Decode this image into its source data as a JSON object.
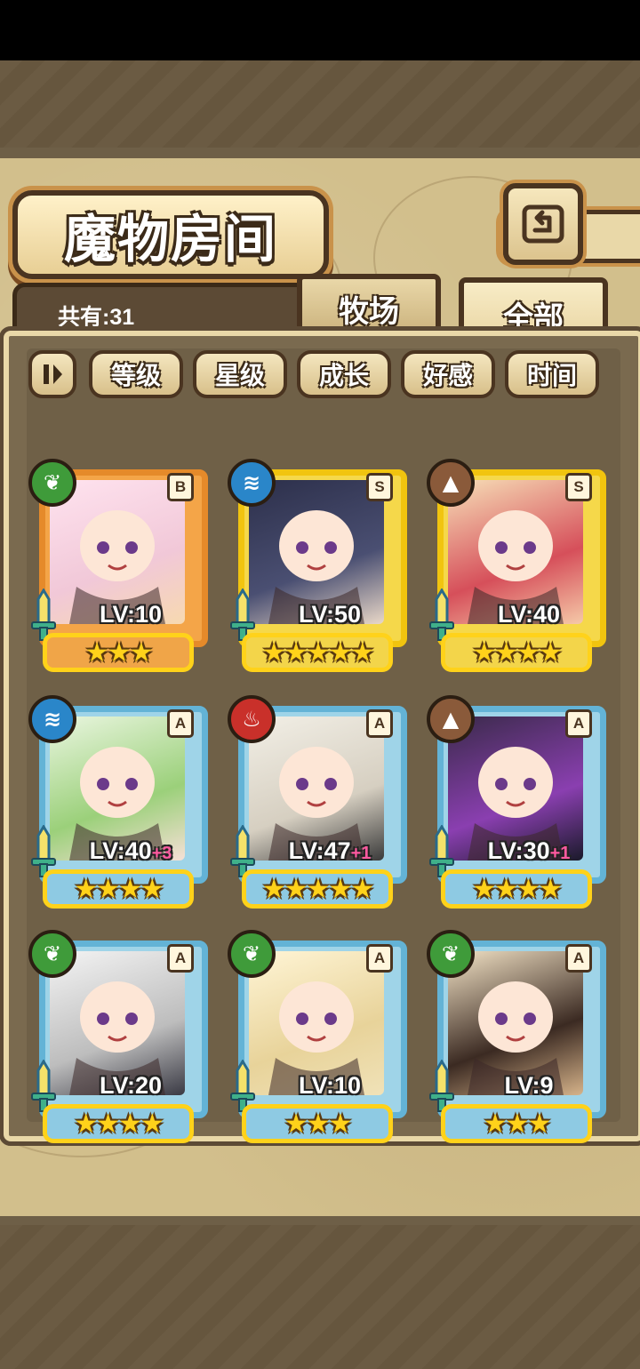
{
  "header": {
    "title": "魔物房间",
    "back_icon": "back-arrow-icon"
  },
  "summary": {
    "count_label": "共有:31"
  },
  "tabs": [
    {
      "label": "牧场",
      "active": false
    },
    {
      "label": "全部",
      "active": true
    }
  ],
  "filters": {
    "toggle_icon": "pause-sort-icon",
    "items": [
      "等级",
      "星级",
      "成长",
      "好感",
      "时间"
    ]
  },
  "monsters": [
    {
      "rank": "B",
      "element": "leaf",
      "level": "LV:10",
      "bonus": "",
      "stars": 3,
      "frame": "bronze"
    },
    {
      "rank": "S",
      "element": "water",
      "level": "LV:50",
      "bonus": "",
      "stars": 5,
      "frame": "gold"
    },
    {
      "rank": "S",
      "element": "earth",
      "level": "LV:40",
      "bonus": "",
      "stars": 4,
      "frame": "gold"
    },
    {
      "rank": "A",
      "element": "water",
      "level": "LV:40",
      "bonus": "+3",
      "stars": 4,
      "frame": "blue"
    },
    {
      "rank": "A",
      "element": "fire",
      "level": "LV:47",
      "bonus": "+1",
      "stars": 5,
      "frame": "blue"
    },
    {
      "rank": "A",
      "element": "earth",
      "level": "LV:30",
      "bonus": "+1",
      "stars": 4,
      "frame": "blue"
    },
    {
      "rank": "A",
      "element": "leaf",
      "level": "LV:20",
      "bonus": "",
      "stars": 4,
      "frame": "blue"
    },
    {
      "rank": "A",
      "element": "leaf",
      "level": "LV:10",
      "bonus": "",
      "stars": 3,
      "frame": "blue"
    },
    {
      "rank": "A",
      "element": "leaf",
      "level": "LV:9",
      "bonus": "",
      "stars": 3,
      "frame": "blue"
    }
  ],
  "colors": {
    "panel_bg": "#6f6047",
    "map_bg": "#d2bf8c",
    "frame_bronze": "#e58a2a",
    "frame_gold": "#f1c40f",
    "frame_blue": "#63b3d6"
  }
}
